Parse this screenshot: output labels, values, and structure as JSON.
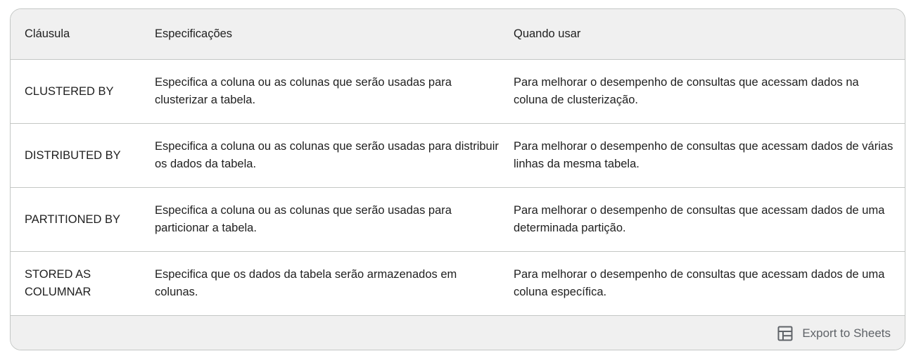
{
  "table": {
    "headers": [
      "Cláusula",
      "Especificações",
      "Quando usar"
    ],
    "rows": [
      {
        "clause": "CLUSTERED BY",
        "spec": "Especifica a coluna ou as colunas que serão usadas para clusterizar a tabela.",
        "when": "Para melhorar o desempenho de consultas que acessam dados na coluna de clusterização."
      },
      {
        "clause": "DISTRIBUTED BY",
        "spec": "Especifica a coluna ou as colunas que serão usadas para distribuir os dados da tabela.",
        "when": "Para melhorar o desempenho de consultas que acessam dados de várias linhas da mesma tabela."
      },
      {
        "clause": "PARTITIONED BY",
        "spec": "Especifica a coluna ou as colunas que serão usadas para particionar a tabela.",
        "when": "Para melhorar o desempenho de consultas que acessam dados de uma determinada partição."
      },
      {
        "clause": "STORED AS COLUMNAR",
        "spec": "Especifica que os dados da tabela serão armazenados em colunas.",
        "when": "Para melhorar o desempenho de consultas que acessam dados de uma coluna específica."
      }
    ]
  },
  "footer": {
    "export_label": "Export to Sheets",
    "export_icon": "table-grid-icon"
  },
  "colors": {
    "header_bg": "#f0f0f0",
    "border": "#c4c7c5",
    "text": "#1f1f1f",
    "export_text": "#5f6368"
  }
}
